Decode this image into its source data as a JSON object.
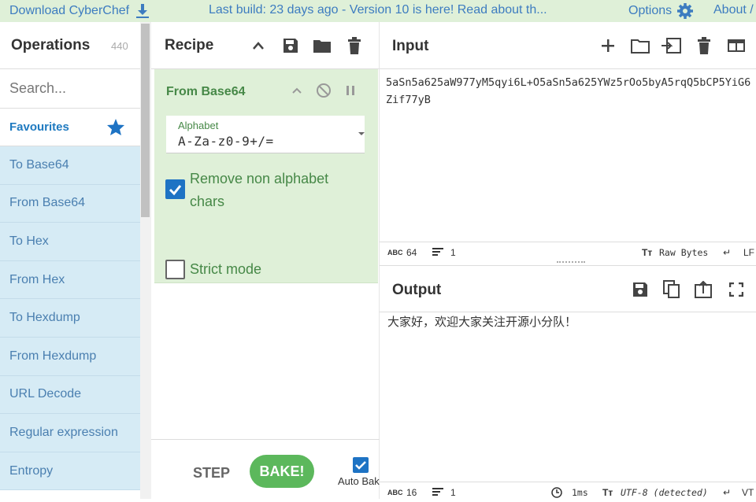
{
  "topbar": {
    "download": "Download CyberChef",
    "banner": "Last build: 23 days ago - Version 10 is here! Read about th...",
    "options": "Options",
    "about": "About /"
  },
  "operations": {
    "title": "Operations",
    "count": "440",
    "search_placeholder": "Search...",
    "favourites": "Favourites",
    "items": [
      "To Base64",
      "From Base64",
      "To Hex",
      "From Hex",
      "To Hexdump",
      "From Hexdump",
      "URL Decode",
      "Regular expression",
      "Entropy"
    ]
  },
  "recipe": {
    "title": "Recipe",
    "operation": {
      "name": "From Base64",
      "alphabet_label": "Alphabet",
      "alphabet_value": "A-Za-z0-9+/=",
      "remove_label_1": "Remove non alphabet",
      "remove_label_2": "chars",
      "strict_label": "Strict mode"
    },
    "step": "STEP",
    "bake": "BAKE!",
    "autobake": "Auto Bake"
  },
  "input": {
    "title": "Input",
    "text": "5aSn5a625aW977yM5qyi6L+O5aSn5a625YWz5rOo5byA5rqQ5bCP5YiG6Zif77yB",
    "status": {
      "abc": "ABC",
      "chars": "64",
      "lines": "1",
      "raw": "Raw Bytes",
      "eol": "LF"
    }
  },
  "output": {
    "title": "Output",
    "text": "大家好，欢迎大家关注开源小分队！",
    "status": {
      "abc": "ABC",
      "chars": "16",
      "lines": "1",
      "time": "1ms",
      "encoding": "UTF-8 (detected)",
      "eol": "VT"
    }
  },
  "colors": {
    "accent": "#1e73c4",
    "green": "#5cb85c",
    "op_bg": "#d6ebf5",
    "recipe_bg": "#dff0d8"
  }
}
